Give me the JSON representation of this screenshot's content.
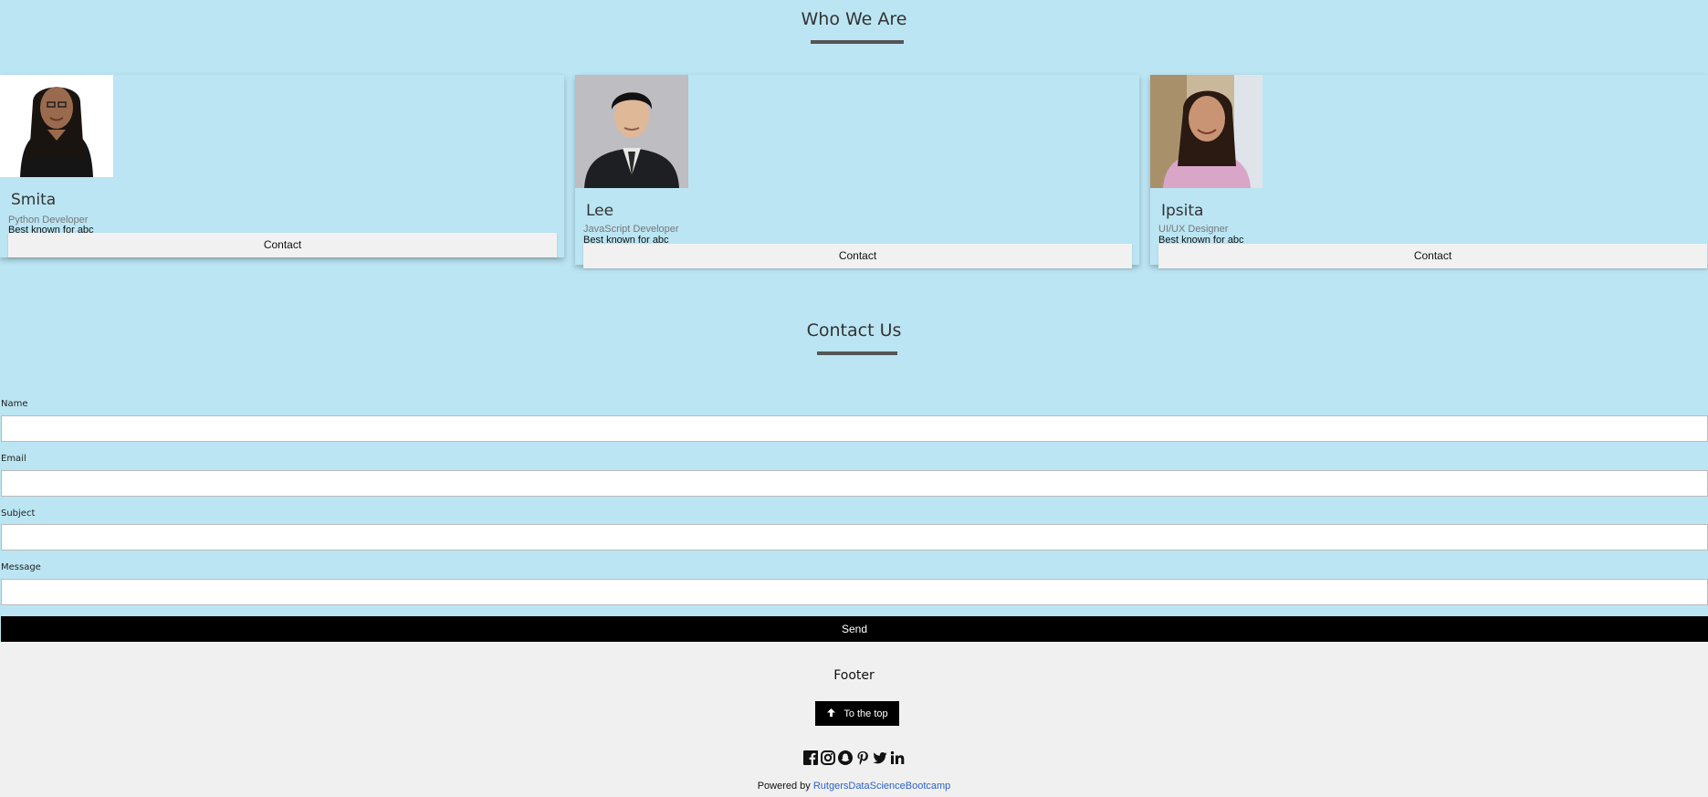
{
  "team": {
    "title": "Who We Are",
    "members": [
      {
        "name": "Smita",
        "role": "Python Developer",
        "desc": "Best known for abc",
        "button": "Contact"
      },
      {
        "name": "Lee",
        "role": "JavaScript Developer",
        "desc": "Best known for abc",
        "button": "Contact"
      },
      {
        "name": "Ipsita",
        "role": "UI/UX Designer",
        "desc": "Best known for abc",
        "button": "Contact"
      }
    ]
  },
  "contact": {
    "title": "Contact Us",
    "fields": {
      "name": {
        "label": "Name",
        "value": ""
      },
      "email": {
        "label": "Email",
        "value": ""
      },
      "subject": {
        "label": "Subject",
        "value": ""
      },
      "message": {
        "label": "Message",
        "value": ""
      }
    },
    "send_label": "Send"
  },
  "footer": {
    "title": "Footer",
    "top_button": "To the top",
    "social_icons": [
      "facebook-icon",
      "instagram-icon",
      "snapchat-icon",
      "pinterest-icon",
      "twitter-icon",
      "linkedin-icon"
    ],
    "powered_prefix": "Powered by",
    "powered_link": "RutgersDataScienceBootcamp"
  }
}
